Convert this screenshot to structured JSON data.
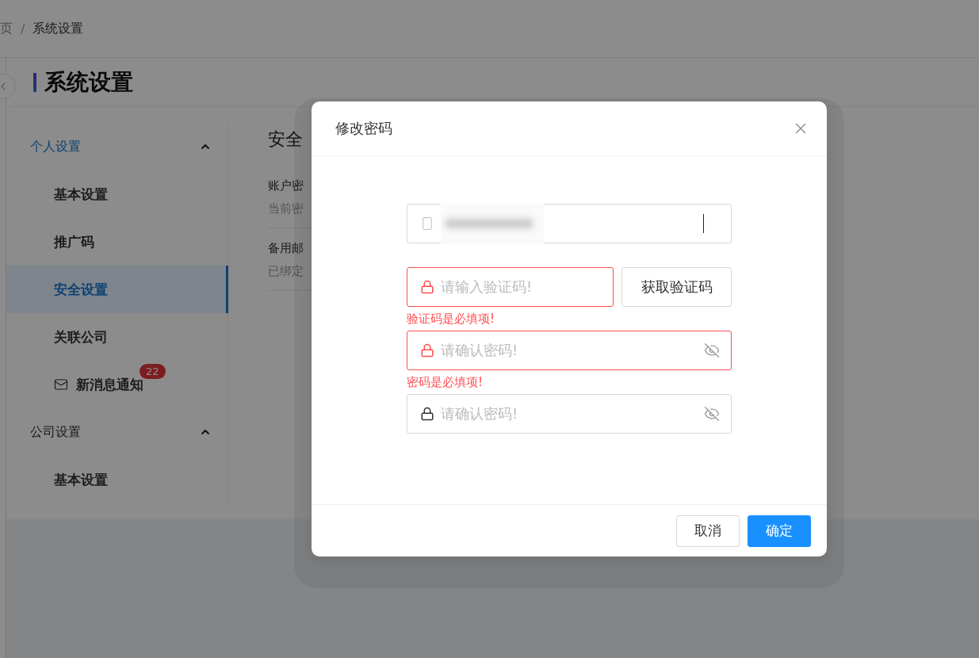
{
  "breadcrumb": {
    "separator": "/",
    "items": [
      "页",
      "系统设置"
    ]
  },
  "page_title": "系统设置",
  "menu": [
    {
      "label": "个人设置",
      "expanded": true,
      "children": [
        {
          "label": "基本设置",
          "selected": false,
          "kind": "plain"
        },
        {
          "label": "推广码",
          "selected": false,
          "kind": "plain"
        },
        {
          "label": "安全设置",
          "selected": true,
          "kind": "plain"
        },
        {
          "label": "关联公司",
          "selected": false,
          "kind": "plain"
        },
        {
          "label": "新消息通知",
          "selected": false,
          "kind": "mail",
          "badge": "22"
        }
      ]
    },
    {
      "label": "公司设置",
      "expanded": true,
      "children": [
        {
          "label": "基本设置",
          "selected": false,
          "kind": "plain"
        }
      ]
    }
  ],
  "content": {
    "title": "安全",
    "items": [
      {
        "label": "账户密",
        "description": "当前密"
      },
      {
        "label": "备用邮",
        "description": "已绑定"
      }
    ]
  },
  "dialog": {
    "title": "修改密码",
    "fields": [
      {
        "kind": "phone",
        "focused": true,
        "error": false
      },
      {
        "kind": "code",
        "placeholder": "请输入验证码!",
        "error": true,
        "message": "验证码是必填项!",
        "button": "获取验证码"
      },
      {
        "kind": "password",
        "placeholder": "请确认密码!",
        "error": true,
        "message": "密码是必填项!"
      },
      {
        "kind": "password",
        "placeholder": "请确认密码!",
        "error": false
      }
    ],
    "buttons": [
      {
        "label": "取消",
        "primary": false
      },
      {
        "label": "确定",
        "primary": true
      }
    ]
  }
}
